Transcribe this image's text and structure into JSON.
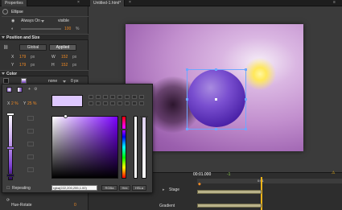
{
  "app": {
    "panel_title": "Properties",
    "doc_tab": "Untitled-1.html*"
  },
  "properties": {
    "element_name": "Ellipse",
    "always_on_label": "Always On",
    "visibility_value": "visible",
    "opacity_value": "100",
    "position_section": "Position and Size",
    "global_label": "Global",
    "applied_label": "Applied",
    "x_label": "X",
    "x_value": "179",
    "y_label": "Y",
    "y_value": "179",
    "w_label": "W",
    "w_value": "152",
    "h_label": "H",
    "h_value": "152",
    "unit": "px",
    "color_section": "Color",
    "fill_none": "none",
    "stroke_width": "0 px",
    "hue_rotate_label": "Hue-Rotate"
  },
  "picker": {
    "x_label": "X",
    "x_value": "2 %",
    "y_label": "Y",
    "y_value": "25 %",
    "repeating_label": "Repeating",
    "color_value": "rgba(222,200,255,1.00)",
    "mode_rgba": "RGBa",
    "mode_hex": "Hex",
    "mode_hsla": "HSLa",
    "swatch_color": "#dec8ff"
  },
  "timeline": {
    "current_time": "00:01.000",
    "time_offset": "-1",
    "ruler_start": "0:01",
    "stage_label": "Stage",
    "gradient_label": "Gradient"
  }
}
